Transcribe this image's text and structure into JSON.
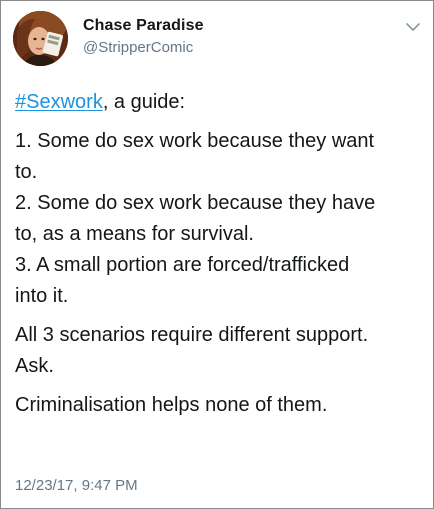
{
  "user": {
    "name": "Chase Paradise",
    "handle": "@StripperComic"
  },
  "tweet": {
    "hashtag": "#Sexwork",
    "intro_rest": ", a guide:",
    "line1": "1. Some do sex work because they want",
    "line1b": "to.",
    "line2": "2. Some do sex work because they have",
    "line2b": "to, as a means for survival.",
    "line3": "3. A small portion are forced/trafficked",
    "line3b": "into it.",
    "para2a": "All 3 scenarios require different support.",
    "para2b": "Ask.",
    "para3": "Criminalisation helps none of them."
  },
  "timestamp": "12/23/17, 9:47 PM",
  "icons": {
    "menu": "chevron-down-icon",
    "avatar": "avatar"
  },
  "colors": {
    "link": "#1b95e0",
    "secondary_text": "#657786",
    "text": "#14171a"
  }
}
